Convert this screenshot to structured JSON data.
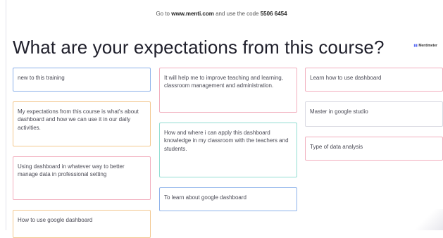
{
  "instruction": {
    "prefix": "Go to",
    "url": "www.menti.com",
    "middle": "and use the code",
    "code": "5506 6454"
  },
  "title": "What are your expectations from this course?",
  "logo": {
    "mark": "▮▮",
    "text": "Mentimeter"
  },
  "cards": [
    "new to this training",
    "My expectations from this course is what's about dashboard and how we can use it in our daily activities.",
    "Using dashboard in whatever way to better manage data in professional setting",
    "How to use google dashboard",
    "It will help me to improve teaching and learning, classroom management and administration.",
    "How and where i can apply this dashboard knowledge in my classroom with the teachers and students.",
    "To learn about google dashboard",
    "Learn how to use dashboard",
    "Master in google studio",
    "Type of data analysis"
  ]
}
